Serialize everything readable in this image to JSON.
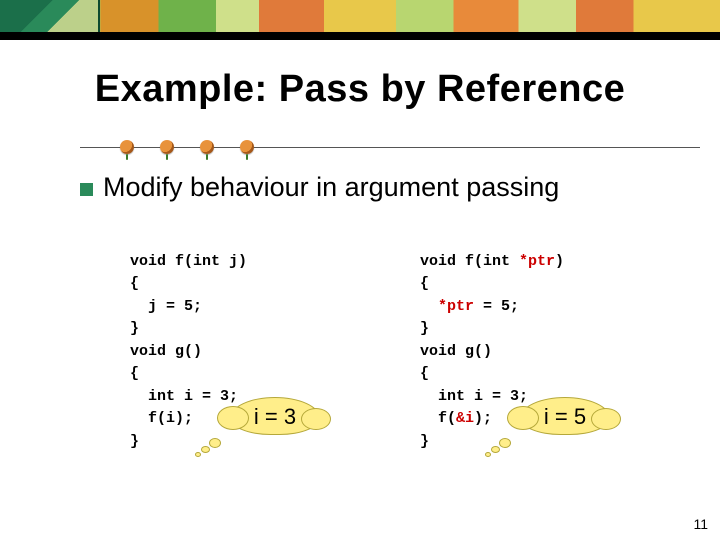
{
  "title": "Example: Pass by Reference",
  "bullet": "Modify behaviour in argument passing",
  "code_left": {
    "l1": "void f(int j)",
    "l2": "{",
    "l3": "  j = 5;",
    "l4": "}",
    "l5": "void g()",
    "l6": "{",
    "l7": "  int i = 3;",
    "l8": "  f(i);",
    "l9": "}",
    "cloud": "i = 3"
  },
  "code_right": {
    "l1a": "void f(int ",
    "l1b": "*ptr",
    "l1c": ")",
    "l2": "{",
    "l3a": "  ",
    "l3b": "*ptr",
    "l3c": " = 5;",
    "l4": "}",
    "l5": "void g()",
    "l6": "{",
    "l7": "  int i = 3;",
    "l8a": "  f(",
    "l8b": "&i",
    "l8c": ");",
    "l9": "}",
    "cloud": "i = 5"
  },
  "page_number": "11"
}
